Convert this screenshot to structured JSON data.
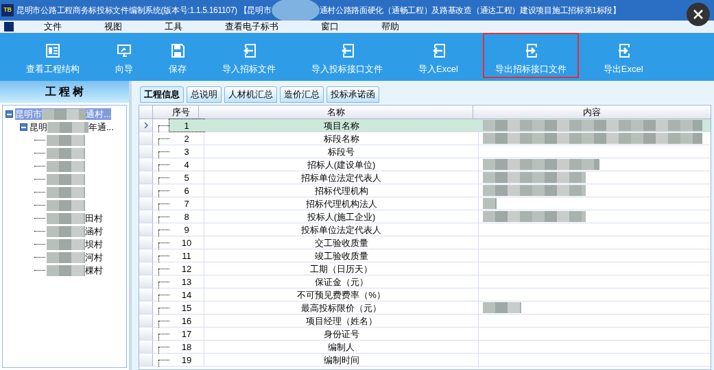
{
  "window": {
    "title_start": "昆明市公路工程商务标投标文件编制系统(版本号:1.1.5.161107) 【昆明市",
    "title_redacted": true,
    "title_end": "通村公路路面硬化（通畅工程）及路基改造（通达工程）建设项目施工招标第1标段】",
    "app_badge": "TB"
  },
  "menu": [
    "文件",
    "视图",
    "工具",
    "查看电子标书",
    "窗口",
    "帮助"
  ],
  "toolbar": [
    {
      "label": "查看工程结构",
      "kind": "structure",
      "selected": false
    },
    {
      "label": "向导",
      "kind": "wizard",
      "selected": false
    },
    {
      "label": "保存",
      "kind": "save",
      "selected": false
    },
    {
      "label": "导入招标文件",
      "kind": "import",
      "selected": false
    },
    {
      "label": "导入投标接口文件",
      "kind": "import",
      "selected": false
    },
    {
      "label": "导入Excel",
      "kind": "import",
      "selected": false
    },
    {
      "label": "导出招标接口文件",
      "kind": "export",
      "selected": true
    },
    {
      "label": "导出Excel",
      "kind": "export",
      "selected": false
    }
  ],
  "tree": {
    "title": "工 程 树",
    "items": [
      {
        "start": "昆明市",
        "end": "通村...",
        "expanded": true,
        "selected": true,
        "children": [
          {
            "start": "昆明",
            "end": "年通...",
            "expanded": true,
            "selected": false,
            "children": [
              {
                "redacted": true,
                "selected": false
              },
              {
                "redacted": true,
                "selected": false
              },
              {
                "redacted": true,
                "selected": false
              },
              {
                "redacted": true,
                "selected": false
              },
              {
                "redacted": true,
                "selected": false
              },
              {
                "redacted": true,
                "selected": false
              },
              {
                "end": "田村",
                "redacted": true,
                "selected": false
              },
              {
                "end": "涵村",
                "redacted": true,
                "selected": false
              },
              {
                "end": "坝村",
                "redacted": true,
                "selected": false
              },
              {
                "end": "河村",
                "redacted": true,
                "selected": false
              },
              {
                "end": "棵村",
                "redacted": true,
                "selected": false
              }
            ]
          }
        ]
      }
    ]
  },
  "tabs": [
    {
      "label": "工程信息",
      "selected": true
    },
    {
      "label": "总说明",
      "selected": false
    },
    {
      "label": "人材机汇总",
      "selected": false
    },
    {
      "label": "造价汇总",
      "selected": false
    },
    {
      "label": "投标承诺函",
      "selected": false
    }
  ],
  "table": {
    "columns": [
      "序号",
      "名称",
      "内容"
    ],
    "rows": [
      {
        "no": "1",
        "name": "项目名称",
        "redacted": true,
        "selected": true
      },
      {
        "no": "2",
        "name": "标段名称",
        "redacted": true,
        "selected": false
      },
      {
        "no": "3",
        "name": "标段号",
        "redacted": false,
        "selected": false
      },
      {
        "no": "4",
        "name": "招标人(建设单位)",
        "redacted": true,
        "selected": false
      },
      {
        "no": "5",
        "name": "招标单位法定代表人",
        "redacted": true,
        "selected": false
      },
      {
        "no": "6",
        "name": "招标代理机构",
        "redacted": true,
        "selected": false
      },
      {
        "no": "7",
        "name": "招标代理机构法人",
        "redacted": true,
        "selected": false
      },
      {
        "no": "8",
        "name": "投标人(施工企业)",
        "redacted": true,
        "selected": false
      },
      {
        "no": "9",
        "name": "投标单位法定代表人",
        "redacted": false,
        "selected": false
      },
      {
        "no": "10",
        "name": "交工验收质量",
        "redacted": false,
        "selected": false
      },
      {
        "no": "11",
        "name": "竣工验收质量",
        "redacted": false,
        "selected": false
      },
      {
        "no": "12",
        "name": "工期（日历天）",
        "redacted": false,
        "selected": false
      },
      {
        "no": "13",
        "name": "保证金（元）",
        "redacted": false,
        "selected": false
      },
      {
        "no": "14",
        "name": "不可预见费费率（%）",
        "redacted": false,
        "selected": false
      },
      {
        "no": "15",
        "name": "最高投标限价（元）",
        "redacted": true,
        "selected": false
      },
      {
        "no": "16",
        "name": "项目经理（姓名）",
        "redacted": false,
        "selected": false
      },
      {
        "no": "17",
        "name": "身份证号",
        "redacted": false,
        "selected": false
      },
      {
        "no": "18",
        "name": "编制人",
        "redacted": false,
        "selected": false
      },
      {
        "no": "19",
        "name": "编制时间",
        "redacted": false,
        "selected": false
      }
    ]
  }
}
